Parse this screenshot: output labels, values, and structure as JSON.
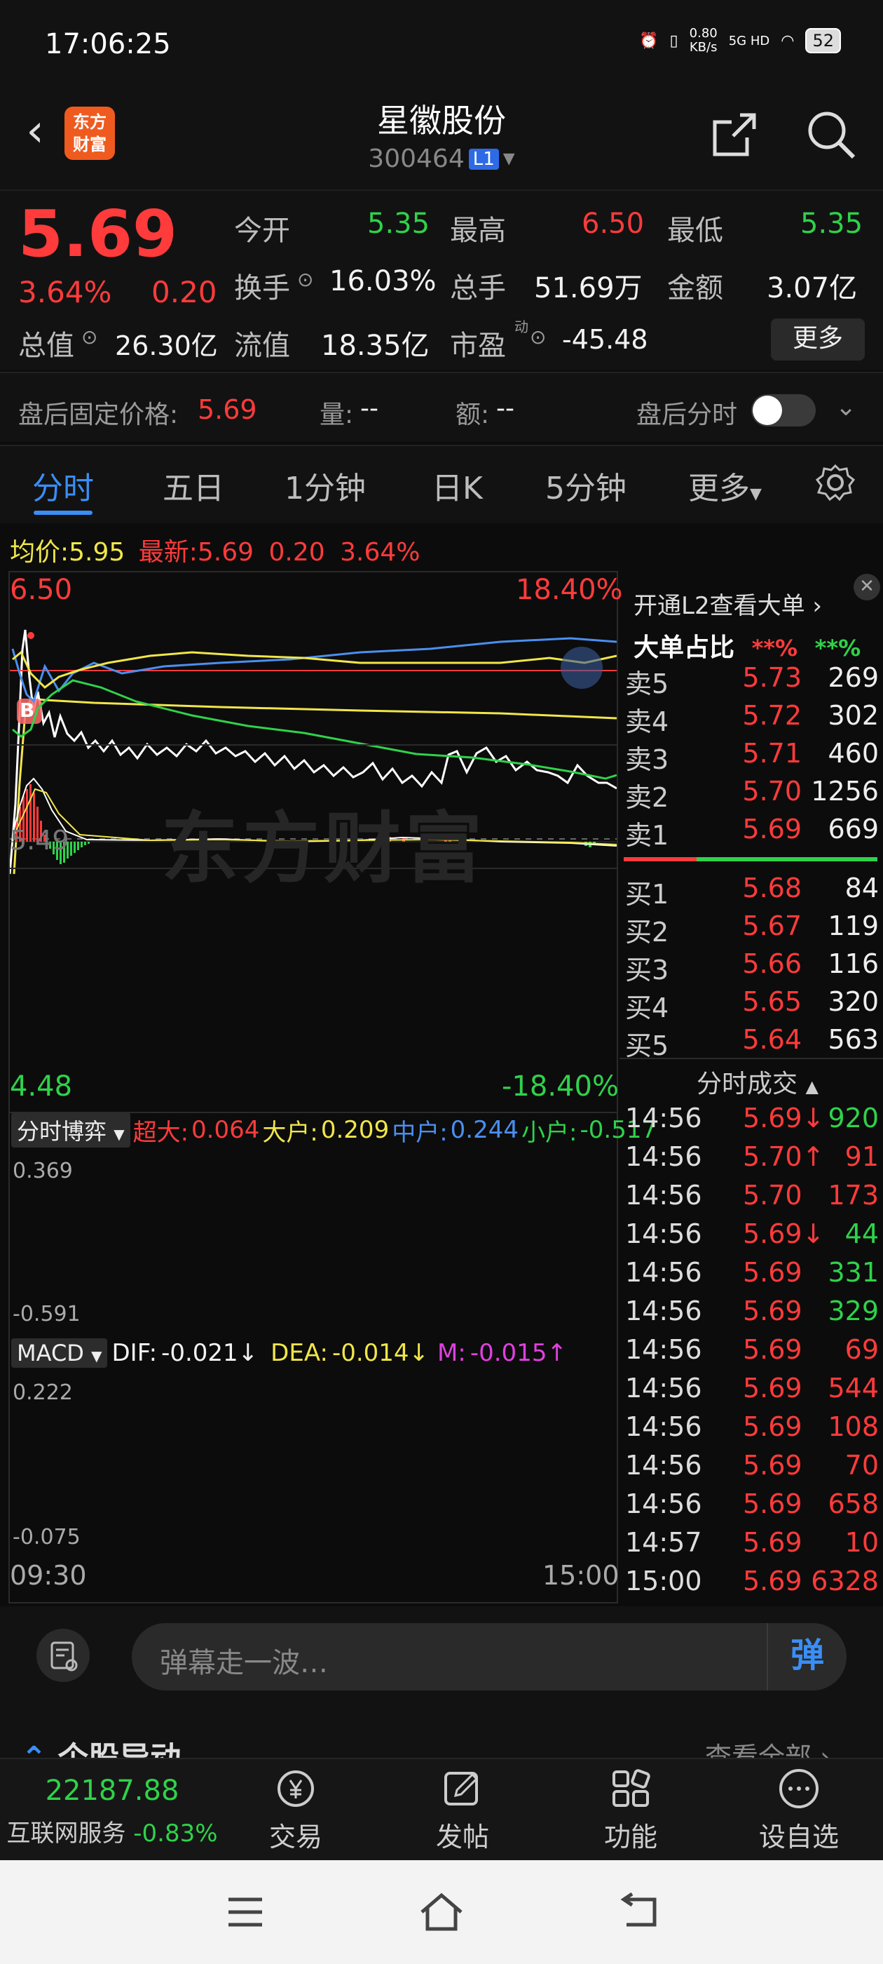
{
  "status_bar": {
    "time": "17:06:25",
    "net_speed": "0.80\nKB/s",
    "net_type": "5G HD",
    "battery": "52"
  },
  "header": {
    "stock_name": "星徽股份",
    "stock_code": "300464",
    "level_badge": "L1",
    "logo_text": "东方\n财富"
  },
  "quote": {
    "price": "5.69",
    "change_pct": "3.64%",
    "change": "0.20",
    "open_label": "今开",
    "open": "5.35",
    "high_label": "最高",
    "high": "6.50",
    "low_label": "最低",
    "low": "5.35",
    "turnover_label": "换手",
    "turnover": "16.03%",
    "volume_label": "总手",
    "volume": "51.69万",
    "amount_label": "金额",
    "amount": "3.07亿",
    "mktcap_label": "总值",
    "mktcap": "26.30亿",
    "float_label": "流值",
    "float_cap": "18.35亿",
    "pe_label": "市盈",
    "pe_sup": "动",
    "pe": "-45.48",
    "more": "更多"
  },
  "after_hours": {
    "fixed_price_label": "盘后固定价格:",
    "fixed_price": "5.69",
    "vol_label": "量:",
    "vol": "--",
    "amt_label": "额:",
    "amt": "--",
    "timeshare_label": "盘后分时"
  },
  "tabs": [
    "分时",
    "五日",
    "1分钟",
    "日K",
    "5分钟",
    "更多"
  ],
  "avg_line": {
    "avg_label": "均价:",
    "avg": "5.95",
    "latest_label": "最新:",
    "latest": "5.69",
    "chg": "0.20",
    "pct": "3.64%"
  },
  "main_chart": {
    "price_high": "6.50",
    "price_low": "4.48",
    "ref_price": "5.49",
    "pct_high": "18.40%",
    "pct_low": "-18.40%",
    "marker": "B",
    "watermark": "东方财富"
  },
  "fund_chart": {
    "selector": "分时博弈",
    "super_label": "超大:",
    "super": "0.064",
    "large_label": "大户:",
    "large": "0.209",
    "mid_label": "中户:",
    "mid": "0.244",
    "small_label": "小户:",
    "small": "-0.517",
    "top": "0.369",
    "bottom": "-0.591"
  },
  "macd_chart": {
    "selector": "MACD",
    "dif_label": "DIF:",
    "dif": "-0.021↓",
    "dea_label": "DEA:",
    "dea": "-0.014↓",
    "m_label": "M:",
    "m": "-0.015↑",
    "top": "0.222",
    "bottom": "-0.075",
    "time_start": "09:30",
    "time_end": "15:00"
  },
  "order_book": {
    "promo": "开通L2查看大单 ›",
    "big_order_label": "大单占比",
    "big_order_red": "**%",
    "big_order_green": "**%",
    "asks": [
      {
        "label": "卖5",
        "price": "5.73",
        "vol": "269"
      },
      {
        "label": "卖4",
        "price": "5.72",
        "vol": "302"
      },
      {
        "label": "卖3",
        "price": "5.71",
        "vol": "460"
      },
      {
        "label": "卖2",
        "price": "5.70",
        "vol": "1256"
      },
      {
        "label": "卖1",
        "price": "5.69",
        "vol": "669"
      }
    ],
    "bids": [
      {
        "label": "买1",
        "price": "5.68",
        "vol": "84"
      },
      {
        "label": "买2",
        "price": "5.67",
        "vol": "119"
      },
      {
        "label": "买3",
        "price": "5.66",
        "vol": "116"
      },
      {
        "label": "买4",
        "price": "5.65",
        "vol": "320"
      },
      {
        "label": "买5",
        "price": "5.64",
        "vol": "563"
      }
    ],
    "trades_header": "分时成交",
    "trades": [
      {
        "time": "14:56",
        "price": "5.69↓",
        "vol": "920",
        "pc": "red",
        "vc": "green"
      },
      {
        "time": "14:56",
        "price": "5.70↑",
        "vol": "91",
        "pc": "red",
        "vc": "red"
      },
      {
        "time": "14:56",
        "price": "5.70",
        "vol": "173",
        "pc": "red",
        "vc": "red"
      },
      {
        "time": "14:56",
        "price": "5.69↓",
        "vol": "44",
        "pc": "red",
        "vc": "green"
      },
      {
        "time": "14:56",
        "price": "5.69",
        "vol": "331",
        "pc": "red",
        "vc": "green"
      },
      {
        "time": "14:56",
        "price": "5.69",
        "vol": "329",
        "pc": "red",
        "vc": "green"
      },
      {
        "time": "14:56",
        "price": "5.69",
        "vol": "69",
        "pc": "red",
        "vc": "red"
      },
      {
        "time": "14:56",
        "price": "5.69",
        "vol": "544",
        "pc": "red",
        "vc": "red"
      },
      {
        "time": "14:56",
        "price": "5.69",
        "vol": "108",
        "pc": "red",
        "vc": "red"
      },
      {
        "time": "14:56",
        "price": "5.69",
        "vol": "70",
        "pc": "red",
        "vc": "red"
      },
      {
        "time": "14:56",
        "price": "5.69",
        "vol": "658",
        "pc": "red",
        "vc": "red"
      },
      {
        "time": "14:57",
        "price": "5.69",
        "vol": "10",
        "pc": "red",
        "vc": "red"
      },
      {
        "time": "15:00",
        "price": "5.69",
        "vol": "6328",
        "pc": "red",
        "vc": "red"
      }
    ]
  },
  "comment": {
    "placeholder": "弹幕走一波…",
    "danmu": "弹"
  },
  "section_peek": {
    "title": "个股异动",
    "link": "查看全部 ›"
  },
  "bottom_nav": {
    "index_value": "22187.88",
    "index_name": "互联网服务",
    "index_pct": "-0.83%",
    "items": [
      "交易",
      "发帖",
      "功能",
      "设自选"
    ]
  },
  "colors": {
    "up": "#ff3b3b",
    "down": "#2fd24a",
    "accent": "#3a8ef6",
    "avg_line": "#f0e64a"
  }
}
